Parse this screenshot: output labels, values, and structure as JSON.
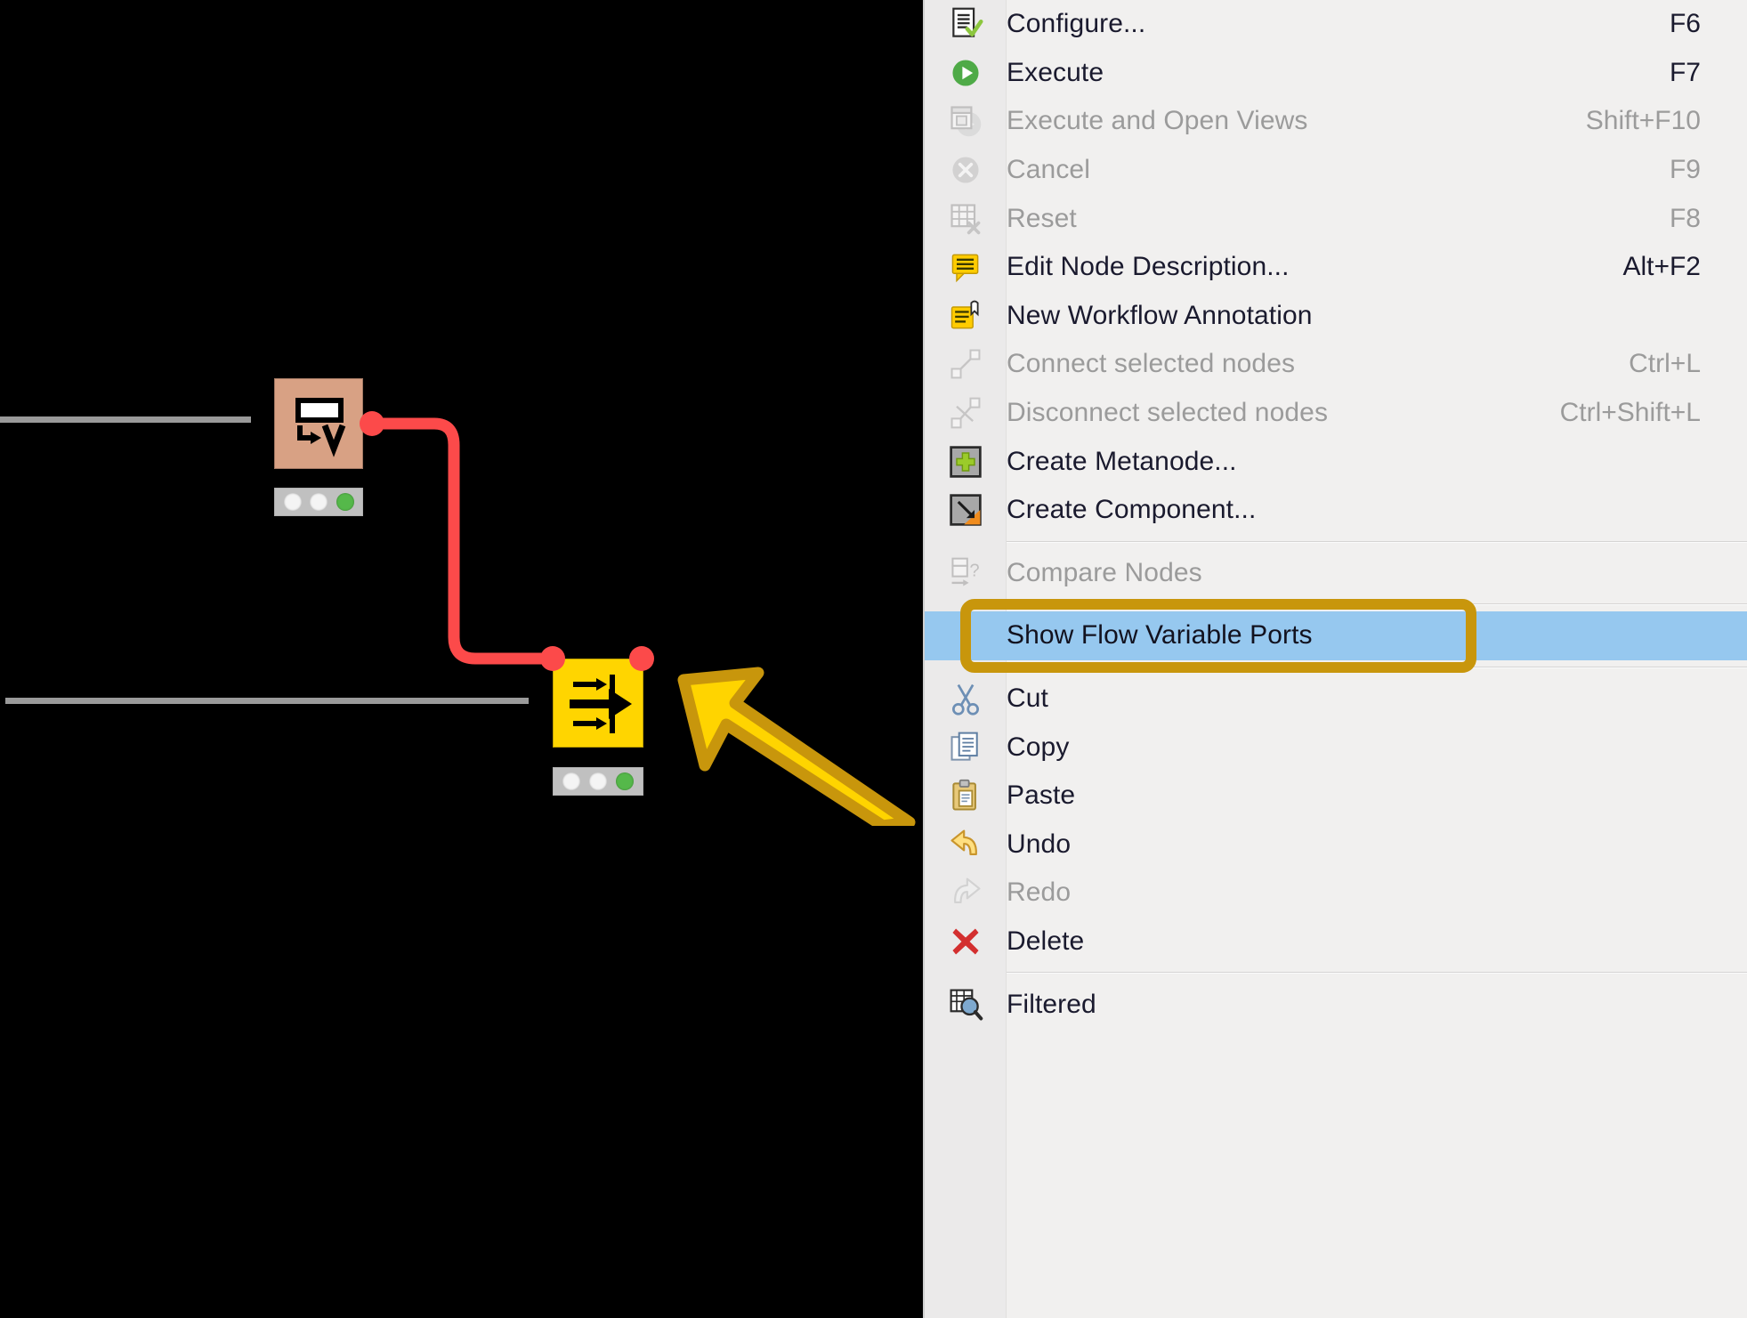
{
  "canvas": {
    "background_color": "#000000",
    "connection_stub_color": "#9a9a9a",
    "wire_color": "#fc4a4a",
    "nodes": [
      {
        "id": "table-row-to-variable",
        "icon": "table-to-variable-icon",
        "body_color": "#d8a184",
        "status_leds": [
          "idle",
          "idle",
          "go"
        ],
        "ports": {
          "out": "flow-variable-out-port"
        }
      },
      {
        "id": "concatenate",
        "icon": "merge-arrows-icon",
        "body_color": "#ffd500",
        "status_leds": [
          "idle",
          "idle",
          "go"
        ],
        "ports": {
          "in": "flow-variable-in-port",
          "out": "flow-variable-out-port"
        }
      }
    ],
    "annotation": {
      "type": "callout-arrow",
      "direction": "up-left",
      "fill_color": "#ffd400",
      "stroke_color": "#c8960c"
    }
  },
  "context_menu": {
    "background_color": "#f1f0ef",
    "selection_color": "#96c8ef",
    "highlight_ring_color": "#c8960c",
    "items": [
      {
        "label": "Configure...",
        "accel": "F6",
        "icon": "configure-icon",
        "disabled": false,
        "selected": false
      },
      {
        "label": "Execute",
        "accel": "F7",
        "icon": "execute-icon",
        "disabled": false,
        "selected": false
      },
      {
        "label": "Execute and Open Views",
        "accel": "Shift+F10",
        "icon": "execute-open-views-icon",
        "disabled": true,
        "selected": false
      },
      {
        "label": "Cancel",
        "accel": "F9",
        "icon": "cancel-icon",
        "disabled": true,
        "selected": false
      },
      {
        "label": "Reset",
        "accel": "F8",
        "icon": "reset-icon",
        "disabled": true,
        "selected": false
      },
      {
        "label": "Edit Node Description...",
        "accel": "Alt+F2",
        "icon": "edit-description-icon",
        "disabled": false,
        "selected": false
      },
      {
        "label": "New Workflow Annotation",
        "accel": "",
        "icon": "new-annotation-icon",
        "disabled": false,
        "selected": false
      },
      {
        "label": "Connect selected nodes",
        "accel": "Ctrl+L",
        "icon": "connect-nodes-icon",
        "disabled": true,
        "selected": false
      },
      {
        "label": "Disconnect selected nodes",
        "accel": "Ctrl+Shift+L",
        "icon": "disconnect-nodes-icon",
        "disabled": true,
        "selected": false
      },
      {
        "label": "Create Metanode...",
        "accel": "",
        "icon": "create-metanode-icon",
        "disabled": false,
        "selected": false
      },
      {
        "label": "Create Component...",
        "accel": "",
        "icon": "create-component-icon",
        "disabled": false,
        "selected": false
      },
      {
        "separator": true
      },
      {
        "label": "Compare Nodes",
        "accel": "",
        "icon": "compare-nodes-icon",
        "disabled": true,
        "selected": false
      },
      {
        "separator": true
      },
      {
        "label": "Show Flow Variable Ports",
        "accel": "",
        "icon": "",
        "disabled": false,
        "selected": true
      },
      {
        "separator": true
      },
      {
        "label": "Cut",
        "accel": "",
        "icon": "cut-icon",
        "disabled": false,
        "selected": false
      },
      {
        "label": "Copy",
        "accel": "",
        "icon": "copy-icon",
        "disabled": false,
        "selected": false
      },
      {
        "label": "Paste",
        "accel": "",
        "icon": "paste-icon",
        "disabled": false,
        "selected": false
      },
      {
        "label": "Undo",
        "accel": "",
        "icon": "undo-icon",
        "disabled": false,
        "selected": false
      },
      {
        "label": "Redo",
        "accel": "",
        "icon": "redo-icon",
        "disabled": true,
        "selected": false
      },
      {
        "label": "Delete",
        "accel": "",
        "icon": "delete-icon",
        "disabled": false,
        "selected": false
      },
      {
        "separator": true
      },
      {
        "label": "Filtered",
        "accel": "",
        "icon": "filtered-icon",
        "disabled": false,
        "selected": false
      }
    ]
  }
}
